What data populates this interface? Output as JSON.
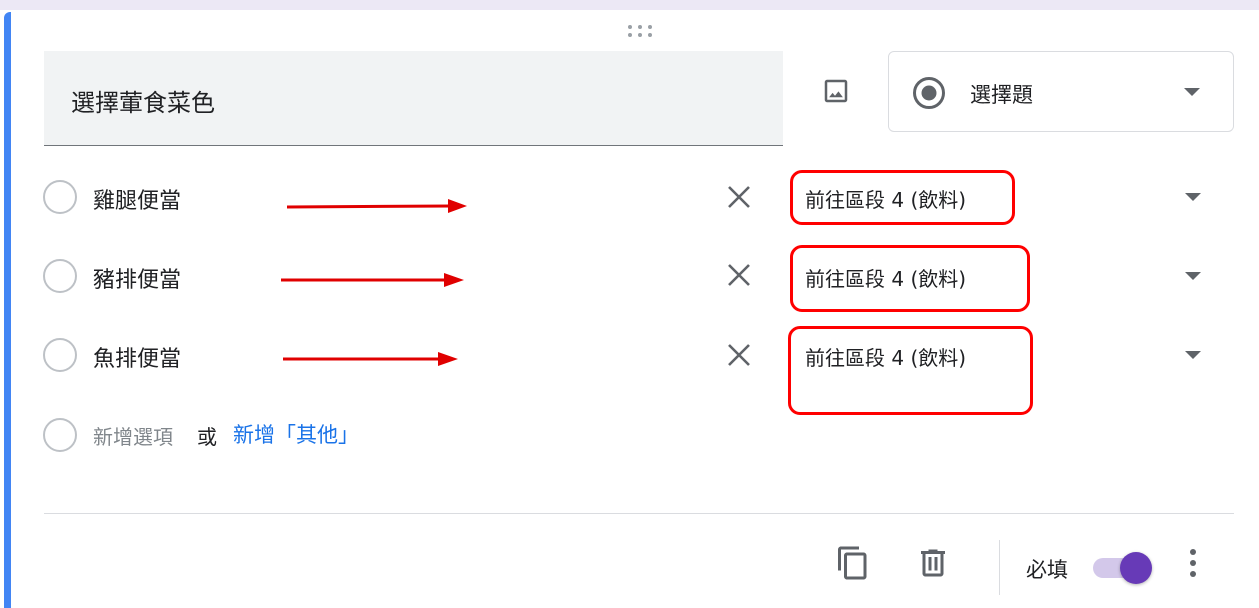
{
  "question": {
    "title": "選擇葷食菜色",
    "type_label": "選擇題",
    "icons": {
      "image": "image-icon",
      "type": "radio-button-icon",
      "type_dropdown": "arrow-drop-down-icon",
      "drag": "drag-indicator-icon"
    }
  },
  "options": [
    {
      "label": "雞腿便當",
      "goto": "前往區段 4 (飲料)"
    },
    {
      "label": "豬排便當",
      "goto": "前往區段 4 (飲料)"
    },
    {
      "label": "魚排便當",
      "goto": "前往區段 4 (飲料)"
    }
  ],
  "add_option": {
    "label": "新增選項",
    "or": "或",
    "add_other": "新增「其他」"
  },
  "footer": {
    "required_label": "必填",
    "required_on": true,
    "icons": [
      "copy-icon",
      "delete-icon",
      "more-vert-icon"
    ]
  },
  "colors": {
    "accent_blue": "#4285f4",
    "link_blue": "#1a73e8",
    "toggle_purple": "#673ab7",
    "annotation_red": "#ff0000"
  }
}
